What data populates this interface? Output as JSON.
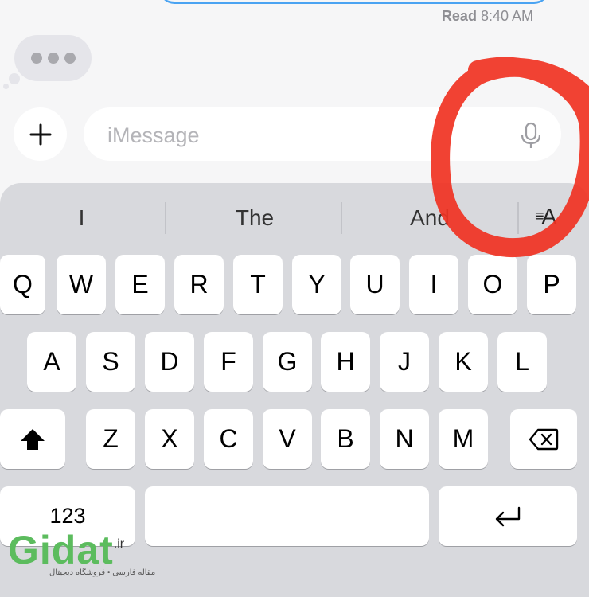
{
  "conversation": {
    "receipt_status": "Read",
    "receipt_time": "8:40 AM",
    "accent_blue": "#3b9bf2"
  },
  "compose": {
    "plus_label": "+",
    "placeholder": "iMessage",
    "mic_icon": "microphone-icon"
  },
  "keyboard": {
    "suggestions": [
      "I",
      "The",
      "And"
    ],
    "format_icon_label": "A",
    "row1": [
      "Q",
      "W",
      "E",
      "R",
      "T",
      "Y",
      "U",
      "I",
      "O",
      "P"
    ],
    "row2": [
      "A",
      "S",
      "D",
      "F",
      "G",
      "H",
      "J",
      "K",
      "L"
    ],
    "row3": [
      "Z",
      "X",
      "C",
      "V",
      "B",
      "N",
      "M"
    ],
    "shift_icon": "shift-icon",
    "delete_icon": "delete-icon",
    "numbers_label": "123",
    "return_icon": "return-icon"
  },
  "annotation": {
    "circle_color": "#f03222"
  },
  "watermark": {
    "logo": "Gidat",
    "tld": ".ir",
    "tagline": "مقاله فارسی • فروشگاه دیجیتال"
  }
}
